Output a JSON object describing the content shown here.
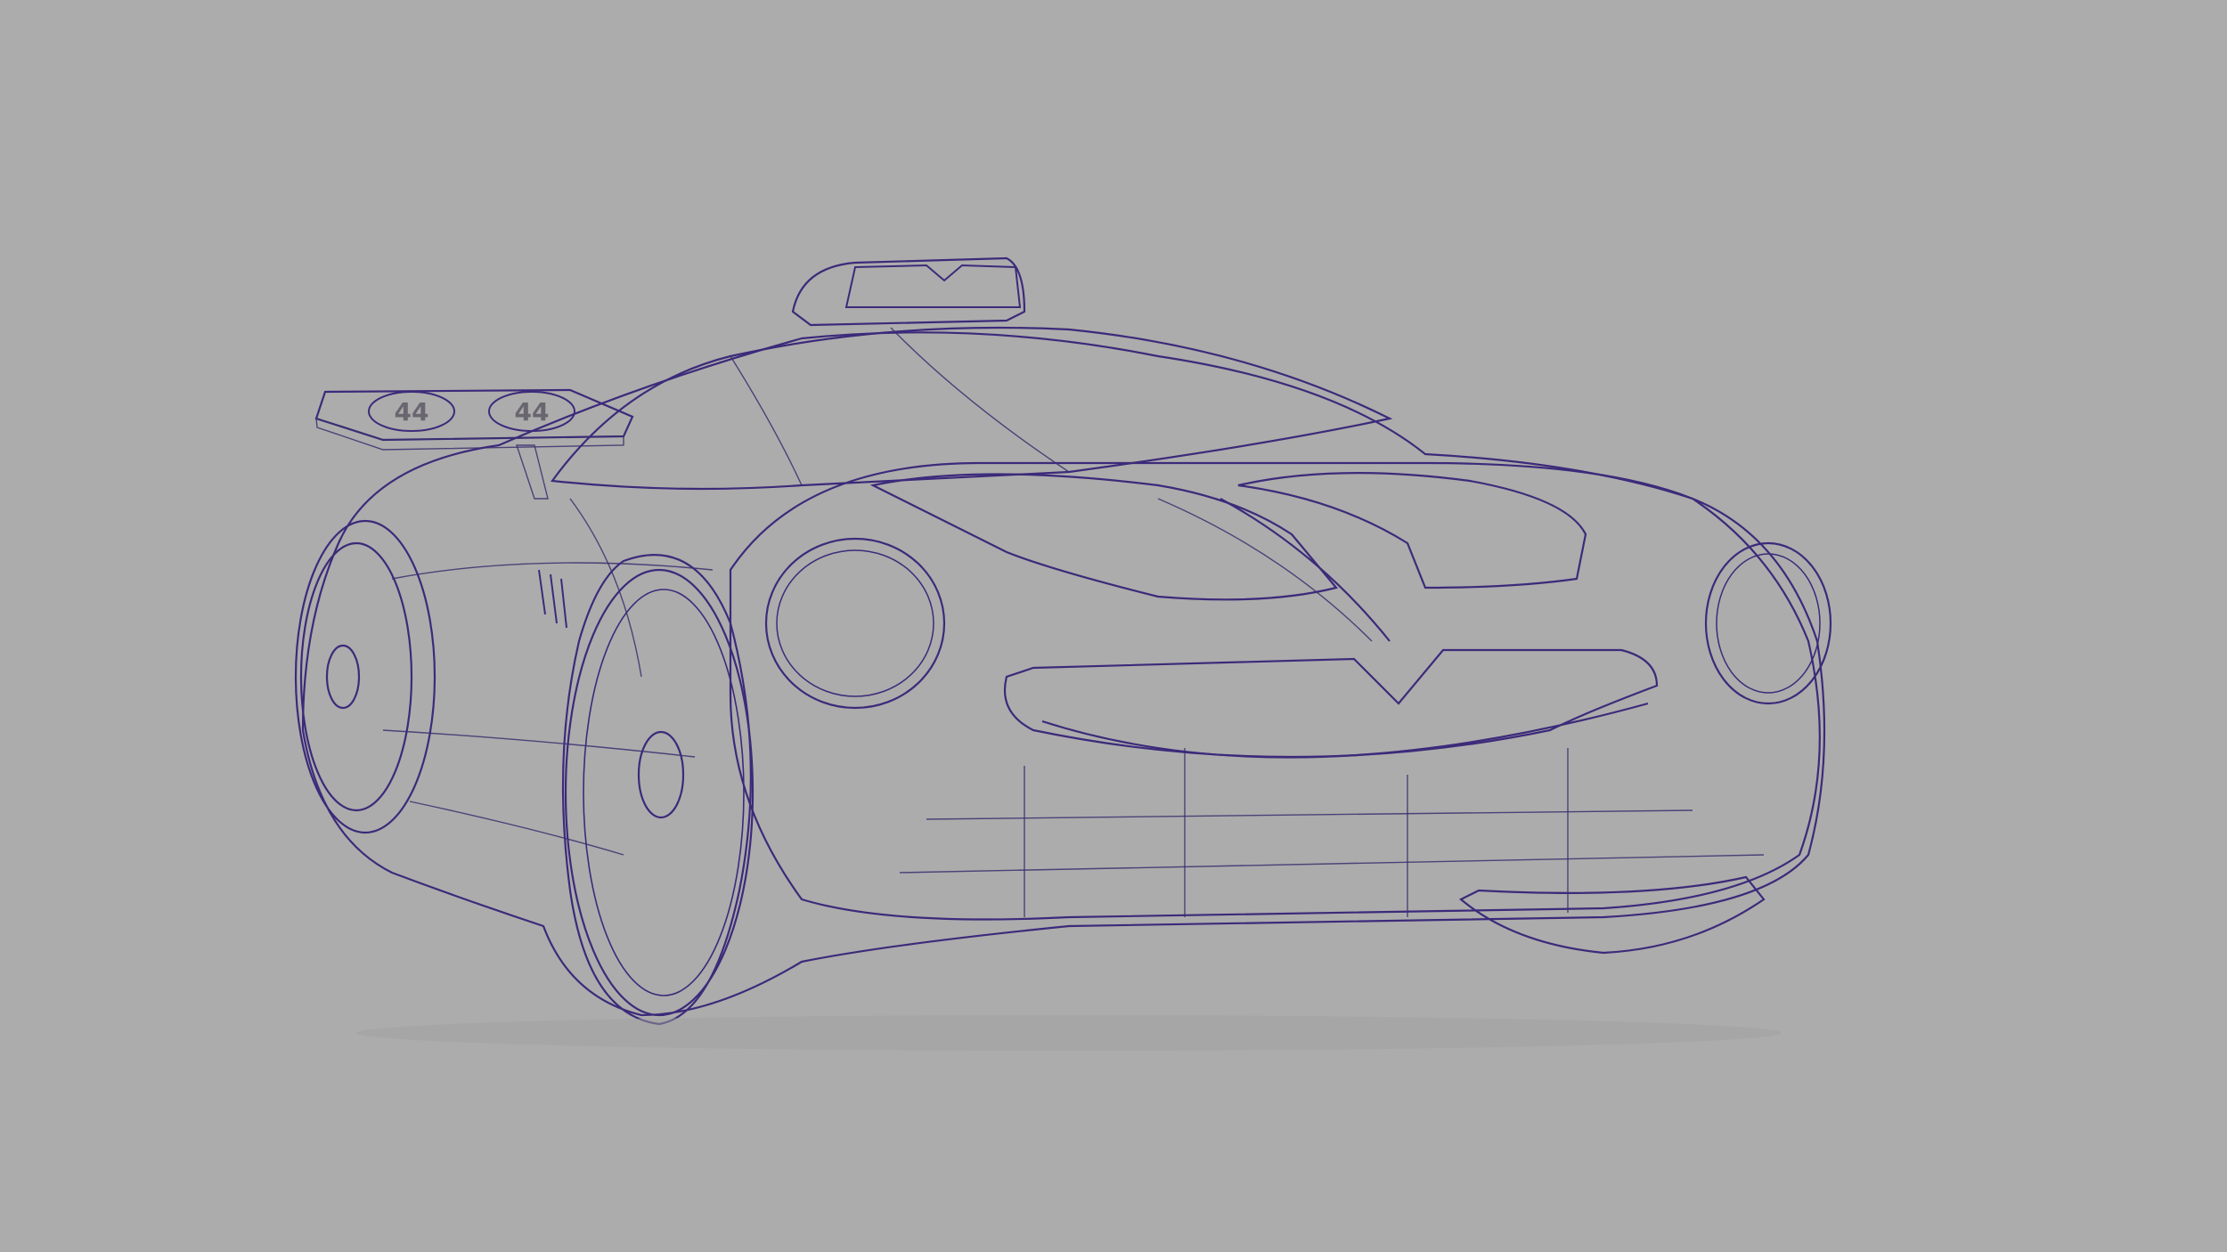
{
  "scene": {
    "background_color": "#acacac",
    "body_color_light": "#e6e3ec",
    "body_color_mid": "#8f8a95",
    "body_color_dark": "#3d3a42",
    "wireframe_color": "#3c2a7a",
    "spoiler_badge": "44"
  }
}
